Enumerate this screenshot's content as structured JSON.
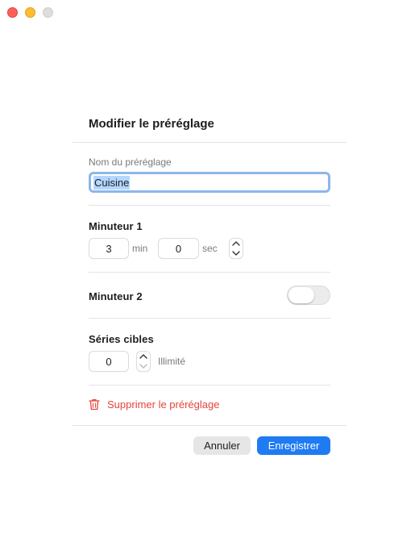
{
  "window": {
    "controls": [
      "close",
      "minimize",
      "zoom"
    ]
  },
  "dialog": {
    "title": "Modifier le préréglage"
  },
  "preset_name": {
    "label": "Nom du préréglage",
    "value": "Cuisine"
  },
  "timer1": {
    "label": "Minuteur 1",
    "minutes": "3",
    "minutes_unit": "min",
    "seconds": "0",
    "seconds_unit": "sec"
  },
  "timer2": {
    "label": "Minuteur 2",
    "enabled": false
  },
  "target_sets": {
    "label": "Séries cibles",
    "value": "0",
    "hint": "Illimité"
  },
  "delete": {
    "label": "Supprimer le préréglage",
    "icon": "trash-icon",
    "color": "#e5443a"
  },
  "footer": {
    "cancel_label": "Annuler",
    "save_label": "Enregistrer",
    "accent": "#1f7bf2"
  }
}
